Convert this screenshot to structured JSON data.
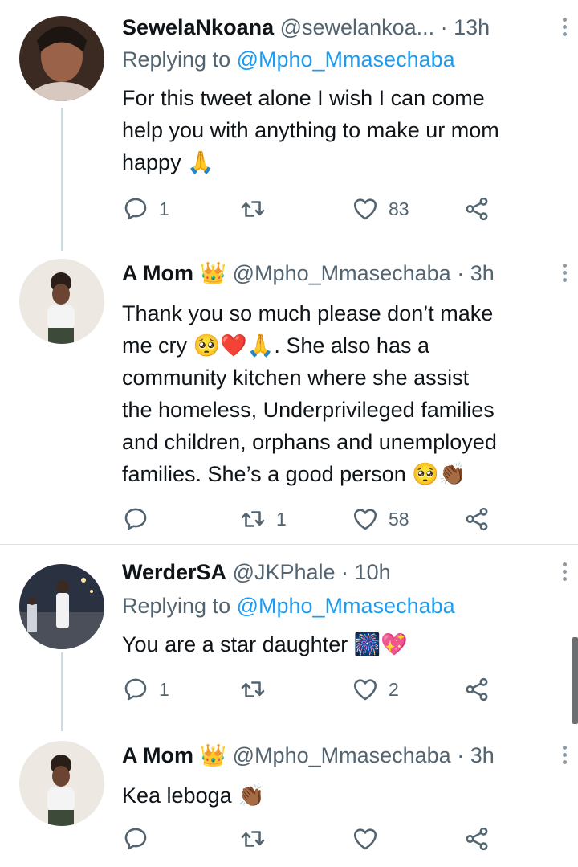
{
  "tweets": [
    {
      "name": "SewelaNkoana",
      "handle": "@sewelankoa...",
      "time": "13h",
      "replying_label": "Replying to ",
      "replying_handle": "@Mpho_Mmasechaba",
      "text": "For this tweet alone I wish I can come\nhelp you with anything to make ur mom\nhappy 🙏",
      "reply_count": "1",
      "retweet_count": "",
      "like_count": "83"
    },
    {
      "name": "A Mom",
      "badge": "👑",
      "handle": "@Mpho_Mmasechaba",
      "time": "3h",
      "text": "Thank you so much please don’t make\nme cry 🥺❤️🙏. She also has a\ncommunity kitchen where she assist\nthe homeless, Underprivileged families\nand children, orphans and unemployed\nfamilies. She’s a good person 🥺👏🏾",
      "reply_count": "",
      "retweet_count": "1",
      "like_count": "58"
    },
    {
      "name": "WerderSA",
      "handle": "@JKPhale",
      "time": "10h",
      "replying_label": "Replying to ",
      "replying_handle": "@Mpho_Mmasechaba",
      "text": "You are a star daughter 🎆💖",
      "reply_count": "1",
      "retweet_count": "",
      "like_count": "2"
    },
    {
      "name": "A Mom",
      "badge": "👑",
      "handle": "@Mpho_Mmasechaba",
      "time": "3h",
      "text": "Kea leboga 👏🏾",
      "reply_count": "",
      "retweet_count": "",
      "like_count": ""
    }
  ],
  "separator": " · ",
  "colors": {
    "link": "#1d9bf0",
    "secondary": "#536471",
    "thread_line": "#cfd9de"
  },
  "icons": [
    "reply-icon",
    "retweet-icon",
    "like-icon",
    "share-icon",
    "more-icon"
  ]
}
